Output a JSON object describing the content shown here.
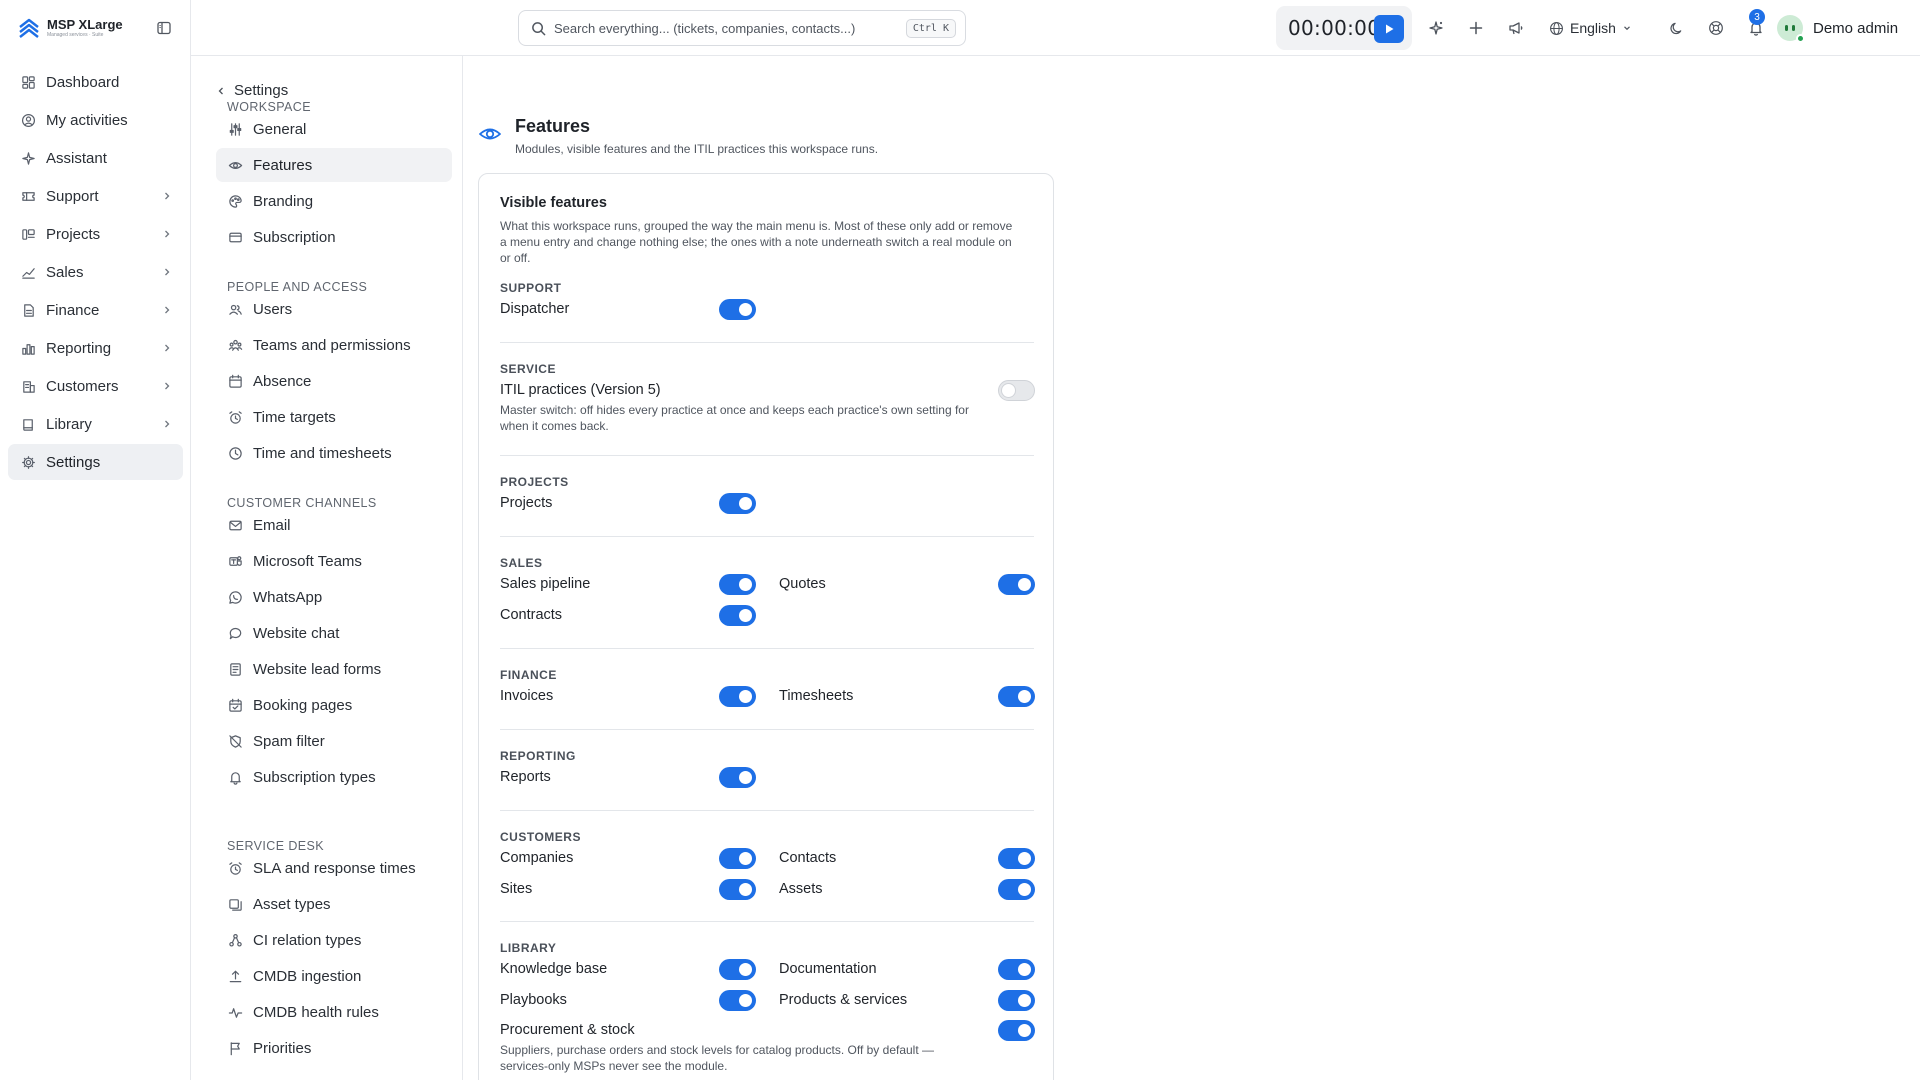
{
  "brand": {
    "name": "MSP XLarge",
    "sub": "Managed services · Suite"
  },
  "app_nav": [
    {
      "label": "Dashboard",
      "icon": "dashboard-icon",
      "chevron": false
    },
    {
      "label": "My activities",
      "icon": "user-circle-icon",
      "chevron": false
    },
    {
      "label": "Assistant",
      "icon": "sparkle-icon",
      "chevron": false
    },
    {
      "label": "Support",
      "icon": "ticket-icon",
      "chevron": true
    },
    {
      "label": "Projects",
      "icon": "projects-icon",
      "chevron": true
    },
    {
      "label": "Sales",
      "icon": "trend-icon",
      "chevron": true
    },
    {
      "label": "Finance",
      "icon": "document-icon",
      "chevron": true
    },
    {
      "label": "Reporting",
      "icon": "bar-chart-icon",
      "chevron": true
    },
    {
      "label": "Customers",
      "icon": "building-icon",
      "chevron": true
    },
    {
      "label": "Library",
      "icon": "book-icon",
      "chevron": true
    },
    {
      "label": "Settings",
      "icon": "gear-icon",
      "chevron": false,
      "active": true
    }
  ],
  "topbar": {
    "search_placeholder": "Search everything... (tickets, companies, contacts...)",
    "search_shortcut": "Ctrl K",
    "timer": "00:00:00",
    "language": "English",
    "notification_count": "3",
    "user_name": "Demo admin"
  },
  "subnav": {
    "back_label": "Settings",
    "sections": [
      {
        "title": "WORKSPACE",
        "items": [
          {
            "label": "General",
            "icon": "sliders-icon"
          },
          {
            "label": "Features",
            "icon": "eye-icon",
            "active": true
          },
          {
            "label": "Branding",
            "icon": "palette-icon"
          },
          {
            "label": "Subscription",
            "icon": "credit-card-icon"
          }
        ]
      },
      {
        "title": "PEOPLE AND ACCESS",
        "items": [
          {
            "label": "Users",
            "icon": "users-icon"
          },
          {
            "label": "Teams and permissions",
            "icon": "team-icon"
          },
          {
            "label": "Absence",
            "icon": "calendar-icon"
          },
          {
            "label": "Time targets",
            "icon": "alarm-icon"
          },
          {
            "label": "Time and timesheets",
            "icon": "clock-icon"
          }
        ]
      },
      {
        "title": "CUSTOMER CHANNELS",
        "items": [
          {
            "label": "Email",
            "icon": "mail-icon"
          },
          {
            "label": "Microsoft Teams",
            "icon": "teams-icon"
          },
          {
            "label": "WhatsApp",
            "icon": "whatsapp-icon"
          },
          {
            "label": "Website chat",
            "icon": "chat-icon"
          },
          {
            "label": "Website lead forms",
            "icon": "form-icon"
          },
          {
            "label": "Booking pages",
            "icon": "calendar-check-icon"
          },
          {
            "label": "Spam filter",
            "icon": "shield-off-icon"
          },
          {
            "label": "Subscription types",
            "icon": "bell-icon"
          }
        ]
      },
      {
        "title": "SERVICE DESK",
        "items": [
          {
            "label": "SLA and response times",
            "icon": "alarm-icon"
          },
          {
            "label": "Asset types",
            "icon": "layers-icon"
          },
          {
            "label": "CI relation types",
            "icon": "network-icon"
          },
          {
            "label": "CMDB ingestion",
            "icon": "upload-icon"
          },
          {
            "label": "CMDB health rules",
            "icon": "pulse-icon"
          },
          {
            "label": "Priorities",
            "icon": "flag-icon"
          }
        ]
      }
    ]
  },
  "page": {
    "title": "Features",
    "subtitle": "Modules, visible features and the ITIL practices this workspace runs."
  },
  "card": {
    "title": "Visible features",
    "description": "What this workspace runs, grouped the way the main menu is. Most of these only add or remove a menu entry and change nothing else; the ones with a note underneath switch a real module on or off.",
    "groups": [
      {
        "label": "SUPPORT",
        "features": [
          {
            "label": "Dispatcher",
            "on": true
          }
        ]
      },
      {
        "label": "SERVICE",
        "features": [
          {
            "label": "ITIL practices (Version 5)",
            "on": false,
            "note": "Master switch: off hides every practice at once and keeps each practice's own setting for when it comes back."
          }
        ]
      },
      {
        "label": "PROJECTS",
        "features": [
          {
            "label": "Projects",
            "on": true
          }
        ]
      },
      {
        "label": "SALES",
        "features": [
          {
            "label": "Sales pipeline",
            "on": true
          },
          {
            "label": "Quotes",
            "on": true
          },
          {
            "label": "Contracts",
            "on": true
          }
        ]
      },
      {
        "label": "FINANCE",
        "features": [
          {
            "label": "Invoices",
            "on": true
          },
          {
            "label": "Timesheets",
            "on": true
          }
        ]
      },
      {
        "label": "REPORTING",
        "features": [
          {
            "label": "Reports",
            "on": true
          }
        ]
      },
      {
        "label": "CUSTOMERS",
        "features": [
          {
            "label": "Companies",
            "on": true
          },
          {
            "label": "Contacts",
            "on": true
          },
          {
            "label": "Sites",
            "on": true
          },
          {
            "label": "Assets",
            "on": true
          }
        ]
      },
      {
        "label": "LIBRARY",
        "features": [
          {
            "label": "Knowledge base",
            "on": true
          },
          {
            "label": "Documentation",
            "on": true
          },
          {
            "label": "Playbooks",
            "on": true
          },
          {
            "label": "Products & services",
            "on": true
          },
          {
            "label": "Procurement & stock",
            "on": true,
            "note": "Suppliers, purchase orders and stock levels for catalog products. Off by default — services-only MSPs never see the module."
          }
        ]
      }
    ]
  },
  "colors": {
    "accent": "#1e6fe6",
    "active_bg": "#eef0f3",
    "border": "#e6e8ec"
  }
}
